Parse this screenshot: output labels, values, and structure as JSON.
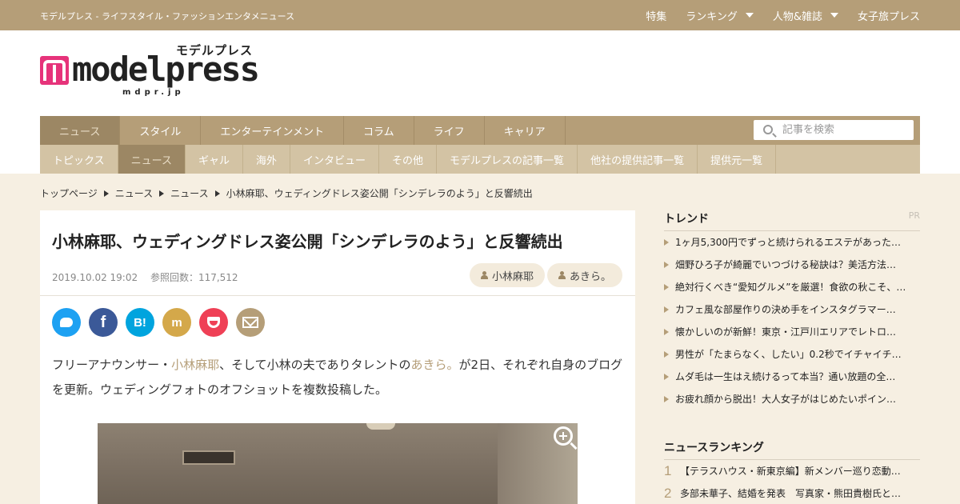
{
  "topbar": {
    "tagline": "モデルプレス - ライフスタイル・ファッションエンタメニュース",
    "nav": [
      {
        "label": "特集",
        "dropdown": false
      },
      {
        "label": "ランキング",
        "dropdown": true
      },
      {
        "label": "人物&雑誌",
        "dropdown": true
      },
      {
        "label": "女子旅プレス",
        "dropdown": false
      }
    ]
  },
  "logo": {
    "kana": "モデルプレス",
    "wordmark": "modelpress",
    "domain": "mdpr.jp",
    "brand_color": "#e6337a"
  },
  "main_nav": [
    "ニュース",
    "スタイル",
    "エンターテインメント",
    "コラム",
    "ライフ",
    "キャリア"
  ],
  "search": {
    "placeholder": "記事を検索"
  },
  "sub_nav": [
    "トピックス",
    "ニュース",
    "ギャル",
    "海外",
    "インタビュー",
    "その他",
    "モデルプレスの記事一覧",
    "他社の提供記事一覧",
    "提供元一覧"
  ],
  "breadcrumb": [
    "トップページ",
    "ニュース",
    "ニュース",
    "小林麻耶、ウェディングドレス姿公開「シンデレラのよう」と反響続出"
  ],
  "article": {
    "title": "小林麻耶、ウェディングドレス姿公開「シンデレラのよう」と反響続出",
    "date": "2019.10.02 19:02",
    "views": "参照回数：117,512",
    "tags": [
      "小林麻耶",
      "あきら。"
    ],
    "share": [
      "twitter-icon",
      "facebook-icon",
      "hatena-icon",
      "mixi-icon",
      "pocket-icon",
      "mail-icon"
    ],
    "body": {
      "p1_pre": "フリーアナウンサー・",
      "p1_link1": "小林麻耶",
      "p1_mid": "、そして小林の夫でありタレントの",
      "p1_link2": "あきら。",
      "p1_post": "が2日、それぞれ自身のブログを更新。ウェディングフォトのオフショットを複数投稿した。"
    }
  },
  "sidebar": {
    "trend_title": "トレンド",
    "pr_label": "PR",
    "trend_items": [
      "1ヶ月5,300円でずっと続けられるエステがあった…",
      "畑野ひろ子が綺麗でいつづける秘訣は？美活方法…",
      "絶対行くべき“愛知グルメ”を厳選！食欲の秋こそ、…",
      "カフェ風な部屋作りの決め手をインスタグラマー…",
      "懐かしいのが新鮮！東京・江戸川エリアでレトロ…",
      "男性が「たまらなく、したい」0.2秒でイチャイチ…",
      "ムダ毛は一生はえ続けるって本当？通い放題の全…",
      "お疲れ顔から脱出！大人女子がはじめたいポイン…"
    ],
    "ranking_title": "ニュースランキング",
    "ranking_items": [
      {
        "num": "1",
        "text": "【テラスハウス・新東京編】新メンバー巡り恋動…"
      },
      {
        "num": "2",
        "text": "多部未華子、結婚を発表　写真家・熊田貴樹氏と…"
      }
    ]
  }
}
